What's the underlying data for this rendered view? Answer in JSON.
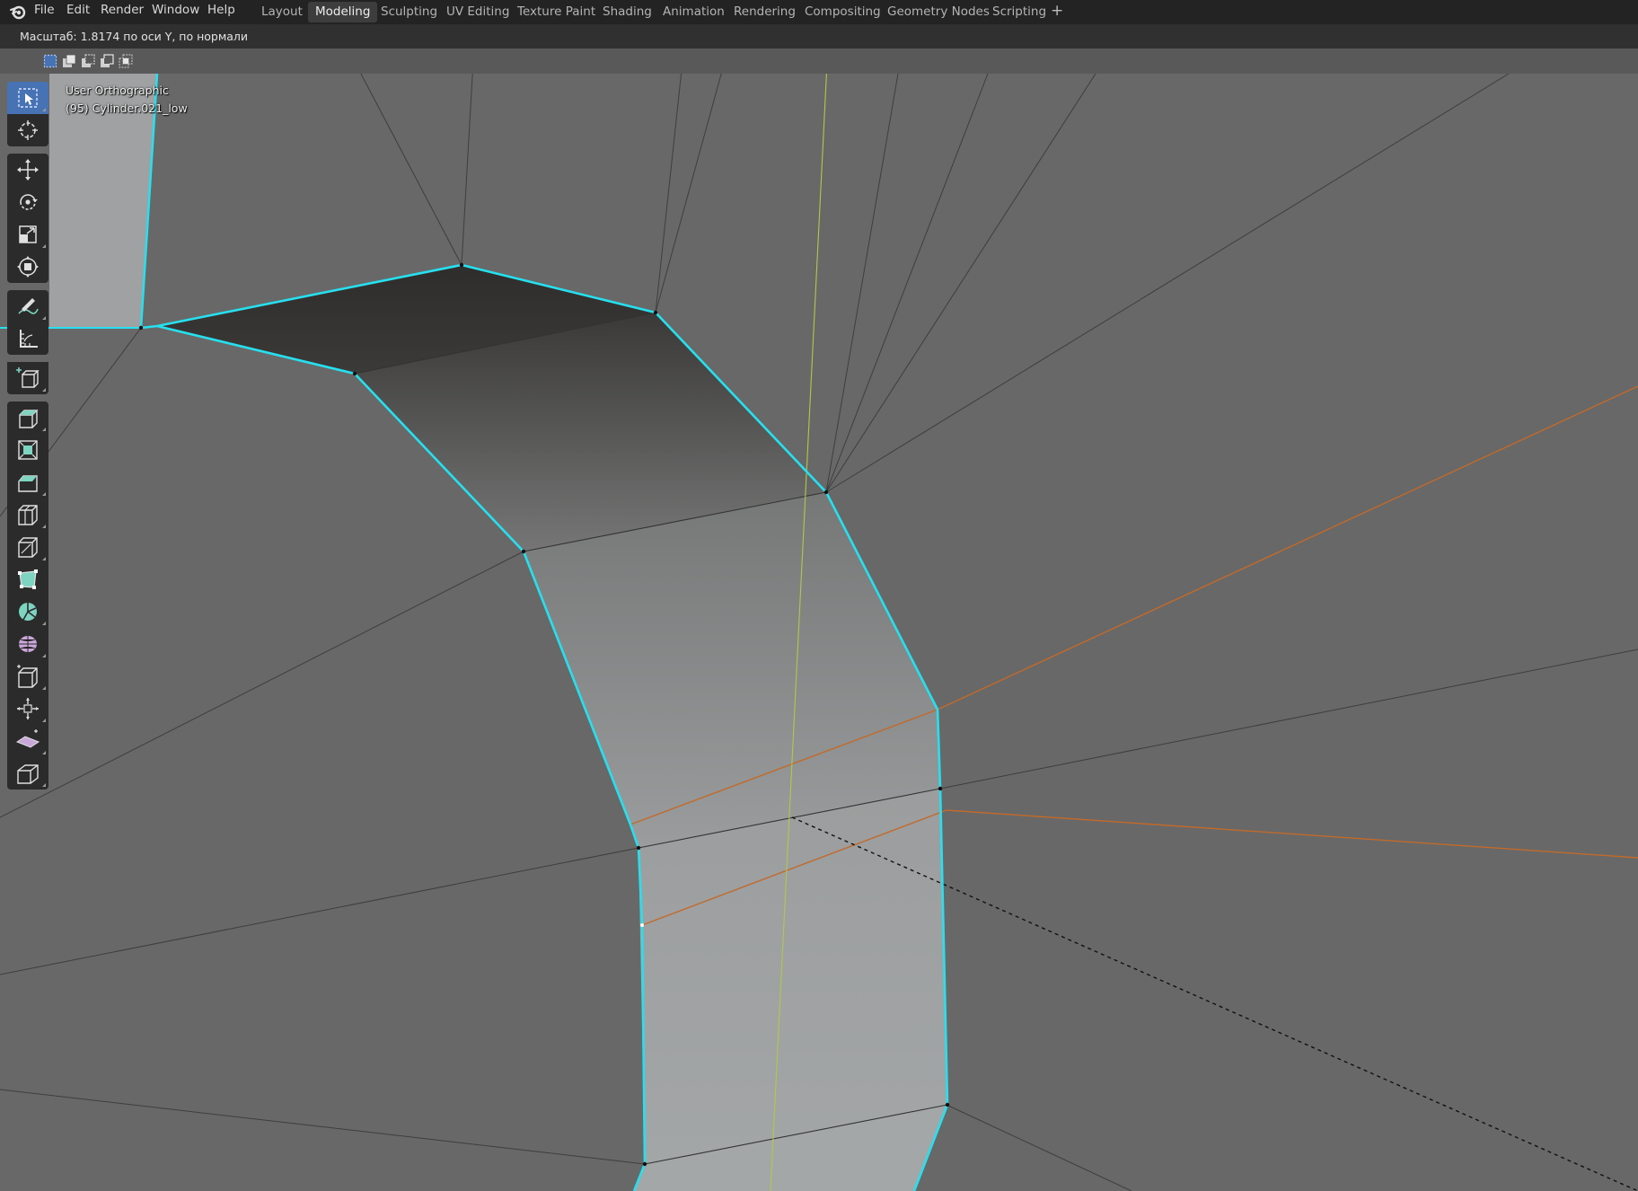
{
  "menu": {
    "items": [
      "File",
      "Edit",
      "Render",
      "Window",
      "Help"
    ]
  },
  "workspaces": {
    "tabs": [
      "Layout",
      "Modeling",
      "Sculpting",
      "UV Editing",
      "Texture Paint",
      "Shading",
      "Animation",
      "Rendering",
      "Compositing",
      "Geometry Nodes",
      "Scripting"
    ],
    "active": "Modeling",
    "add_label": "+"
  },
  "status": {
    "operator_text": "Масштаб: 1.8174 по оси Y, по нормали"
  },
  "viewport": {
    "view_name": "User Orthographic",
    "object_name": "(95) Cylinder.021_low"
  },
  "colors": {
    "top_bar": "#232323",
    "status_bar": "#303030",
    "header": "#595959",
    "viewport_bg": "#686868",
    "selected_edge": "#27e0ef",
    "loop_cut_guide": "#c26a2a",
    "y_axis_line": "#b0c84a",
    "active_tool": "#4772b3",
    "tool_button": "#2b2b2b"
  },
  "toolbar": {
    "tools": [
      "select-box-icon",
      "cursor-icon",
      "move-icon",
      "rotate-icon",
      "scale-icon",
      "transform-icon",
      "annotate-icon",
      "measure-icon",
      "add-cube-icon",
      "extrude-region-icon",
      "inset-faces-icon",
      "bevel-icon",
      "loop-cut-icon",
      "knife-icon",
      "poly-build-icon",
      "spin-icon",
      "smooth-icon",
      "edge-slide-icon",
      "shrink-fatten-icon",
      "shear-icon",
      "rip-region-icon"
    ],
    "active_tool": "select-box-icon"
  },
  "select_modes": [
    "select-new-icon",
    "select-extend-icon",
    "select-subtract-icon",
    "select-invert-icon",
    "select-intersect-icon"
  ]
}
